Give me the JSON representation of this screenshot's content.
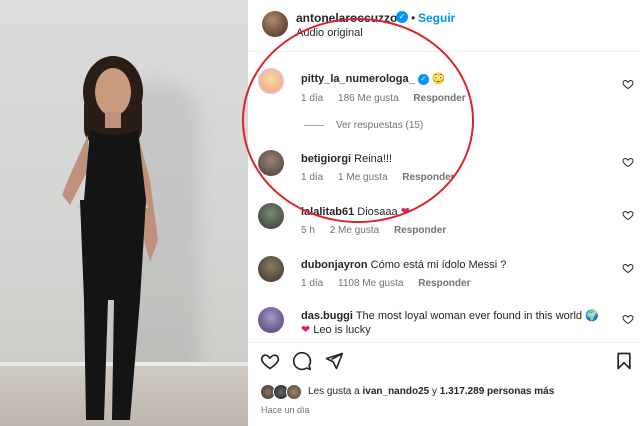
{
  "post": {
    "username": "antonelaroccuzzo",
    "separator": "•",
    "follow_label": "Seguir",
    "audio_label": "Audio original"
  },
  "comments": [
    {
      "username": "pitty_la_numerologa_",
      "text": "",
      "emoji": "😳",
      "time": "1 día",
      "likes": "186 Me gusta",
      "reply": "Responder",
      "avatar_color": "#f1c08a"
    },
    {
      "username": "betigiorgi",
      "text": "Reina!!!",
      "time": "1 día",
      "likes": "1 Me gusta",
      "reply": "Responder",
      "avatar_color": "#6b5a50"
    },
    {
      "username": "lalalitab61",
      "text": "Diosaaa",
      "emoji": "❤️",
      "time": "5 h",
      "likes": "2 Me gusta",
      "reply": "Responder",
      "avatar_color": "#4e5a4a"
    },
    {
      "username": "dubonjayron",
      "text": "Cómo está mi ídolo Messi ?",
      "time": "1 día",
      "likes": "1108 Me gusta",
      "reply": "Responder",
      "avatar_color": "#5a5040"
    },
    {
      "username": "das.buggi",
      "text": "The most loyal woman ever found in this world",
      "text_line2": "Leo is lucky",
      "emoji": "🌍",
      "emoji2": "❤️",
      "avatar_color": "#6a5a8a"
    }
  ],
  "view_replies": "Ver respuestas (15)",
  "likes_summary": {
    "prefix": "Les gusta a",
    "user": "ivan_nando25",
    "middle": "y",
    "count": "1.317.289 personas más"
  },
  "time_ago": "Hace un día",
  "colors": {
    "accent": "#0095f6",
    "highlight": "#d9262c",
    "heart_red": "#e0245e"
  },
  "icons": [
    "heart-icon",
    "comment-icon",
    "share-icon",
    "bookmark-icon",
    "verified-badge-icon"
  ]
}
